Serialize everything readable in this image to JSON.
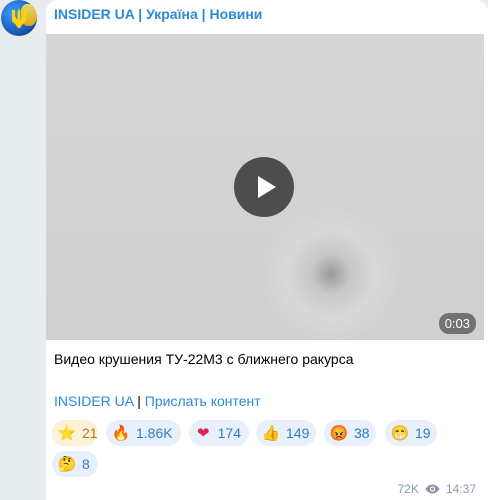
{
  "channel": {
    "name": "INSIDER UA | Україна | Новини"
  },
  "video": {
    "duration": "0:03"
  },
  "caption": "Видео крушения ТУ-22М3 с ближнего ракурса",
  "links": {
    "channel_link": "INSIDER UA",
    "separator": " | ",
    "submit_link": "Прислать контент"
  },
  "reactions": [
    {
      "icon": "star-icon",
      "emoji": "⭐",
      "count": "21"
    },
    {
      "icon": "fire-icon",
      "emoji": "🔥",
      "count": "1.86K"
    },
    {
      "icon": "heart-icon",
      "emoji": "❤",
      "count": "174"
    },
    {
      "icon": "thumbs-up-icon",
      "emoji": "👍",
      "count": "149"
    },
    {
      "icon": "angry-face-icon",
      "emoji": "😡",
      "count": "38"
    },
    {
      "icon": "grinning-face-icon",
      "emoji": "😁",
      "count": "19"
    },
    {
      "icon": "thinking-face-icon",
      "emoji": "🤔",
      "count": "8"
    }
  ],
  "meta": {
    "views": "72K",
    "time": "14:37"
  },
  "colors": {
    "link": "#2b8ad6",
    "reaction_bg": "#e8f1fb",
    "paid_reaction_bg": "#fdf1d7"
  }
}
